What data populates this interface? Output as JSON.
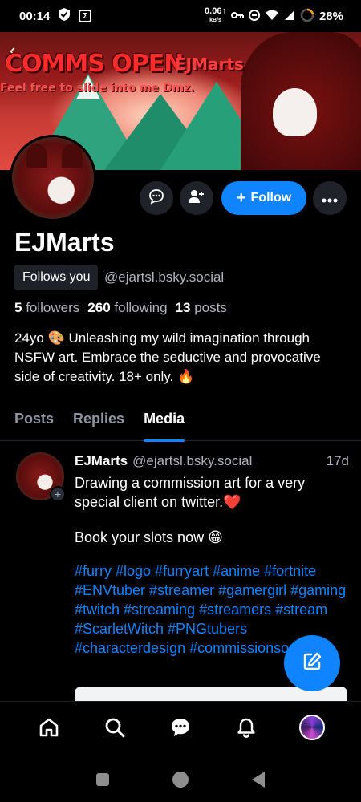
{
  "status_bar": {
    "time": "00:14",
    "net_speed": "0.06↑",
    "net_unit": "kB/s",
    "battery": "28%"
  },
  "banner": {
    "headline": "COMMS OPEN",
    "tagline": "Feel free to slide into me Dmz.",
    "brand": "EJMarts"
  },
  "actions": {
    "follow_label": "Follow"
  },
  "profile": {
    "display_name": "EJMarts",
    "follows_you": "Follows you",
    "handle": "@ejartsl.bsky.social",
    "followers_count": "5",
    "followers_label": "followers",
    "following_count": "260",
    "following_label": "following",
    "posts_count": "13",
    "posts_label": "posts",
    "bio": "24yo 🎨 Unleashing my wild imagination through NSFW art. Embrace the seductive and provocative side of creativity. 18+ only. 🔥"
  },
  "tabs": [
    {
      "label": "Posts",
      "active": false
    },
    {
      "label": "Replies",
      "active": false
    },
    {
      "label": "Media",
      "active": true
    }
  ],
  "post": {
    "author": "EJMarts",
    "handle": "@ejartsl.bsky.social",
    "time": "17d",
    "text_line1": "Drawing a  commission art for a very special client on twitter.❤️",
    "text_line2": "Book your slots now 😁",
    "hashtags": "#furry #logo #furryart  #anime #fortnite #ENVtuber #streamer #gamergirl #gaming #twitch #streaming #streamers #stream #ScarletWitch #PNGtubers #characterdesign #commissionsopen"
  },
  "colors": {
    "accent": "#1083fe",
    "background": "#000000",
    "muted_text": "#aeb4bf",
    "button_bg": "#1f2229"
  },
  "icons": {
    "bottom_nav": [
      "home-icon",
      "search-icon",
      "chat-icon",
      "bell-icon",
      "profile-avatar"
    ],
    "android_nav": [
      "recents-icon",
      "home-circle-icon",
      "back-icon"
    ]
  }
}
